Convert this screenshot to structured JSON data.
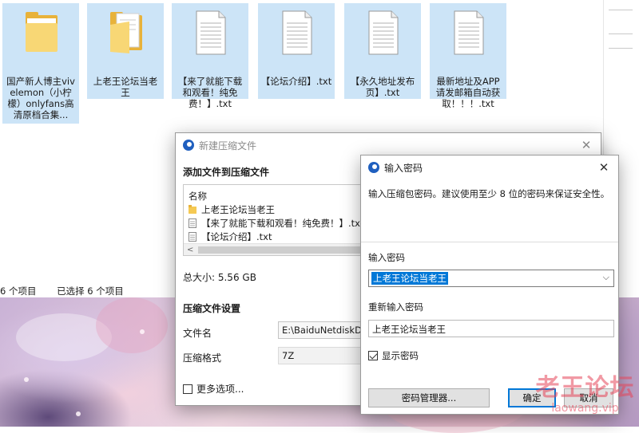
{
  "explorer": {
    "items": [
      {
        "name": "国产新人博主vivelemon（小柠檬）onlyfans高清原档合集...",
        "kind": "folder"
      },
      {
        "name": "上老王论坛当老王",
        "kind": "folder"
      },
      {
        "name": "【来了就能下载和观看！纯免费！】.txt",
        "kind": "txt"
      },
      {
        "name": "【论坛介绍】.txt",
        "kind": "txt"
      },
      {
        "name": "【永久地址发布页】.txt",
        "kind": "txt"
      },
      {
        "name": "最新地址及APP请发邮箱自动获取！！！.txt",
        "kind": "txt"
      }
    ],
    "status": {
      "count": "6 个项目",
      "selected": "已选择 6 个项目"
    }
  },
  "archive_dialog": {
    "title": "新建压缩文件",
    "add_files_heading": "添加文件到压缩文件",
    "list_header": "名称",
    "files": [
      "上老王论坛当老王",
      "【来了就能下载和观看！纯免费！】.txt",
      "【论坛介绍】.txt"
    ],
    "total_size": "总大小: 5.56 GB",
    "settings_heading": "压缩文件设置",
    "filename_label": "文件名",
    "filename_value": "E:\\BaiduNetdiskDow",
    "format_label": "压缩格式",
    "format_value": "7Z",
    "more_options": "更多选项..."
  },
  "password_dialog": {
    "title": "输入密码",
    "hint": "输入压缩包密码。建议使用至少 8 位的密码来保证安全性。",
    "password_label": "输入密码",
    "password_value": "上老王论坛当老王",
    "confirm_label": "重新输入密码",
    "confirm_value": "上老王论坛当老王",
    "show_password": "显示密码",
    "show_password_checked": true,
    "manager_button": "密码管理器...",
    "ok_button": "确定",
    "cancel_button": "取消"
  },
  "watermark": {
    "text": "老王论坛",
    "url": "laowang.vip"
  },
  "colors": {
    "selection": "#cce4f7",
    "accent": "#0078d7",
    "folder": "#f5c953"
  }
}
